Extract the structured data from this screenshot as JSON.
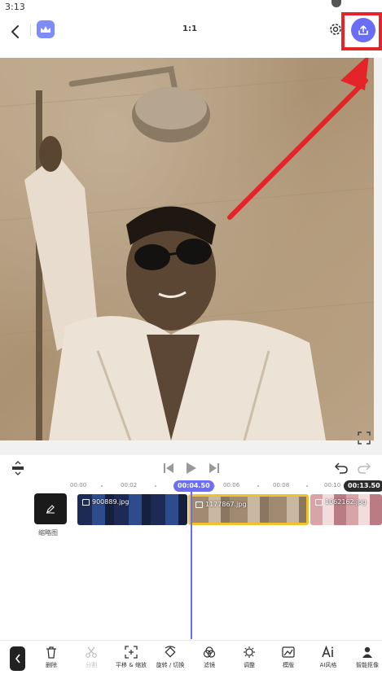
{
  "status": {
    "time": "3:13"
  },
  "header": {
    "ratio": "1:1"
  },
  "timeline": {
    "current_time": "00:04.50",
    "total_time": "00:13.50",
    "ticks": [
      "00:00",
      "00:02",
      "00:06",
      "00:08",
      "00:10"
    ],
    "cover_label": "缩略图",
    "clips": [
      {
        "name": "900889.jpg"
      },
      {
        "name": "1177867.jpg"
      },
      {
        "name": "1062162.jpg"
      }
    ]
  },
  "toolbar": {
    "tools": [
      {
        "label": "删除",
        "icon": "trash-icon"
      },
      {
        "label": "分割",
        "icon": "scissors-icon"
      },
      {
        "label": "平移 & 缩放",
        "icon": "pan-zoom-icon"
      },
      {
        "label": "旋转 / 切换",
        "icon": "rotate-icon"
      },
      {
        "label": "滤镜",
        "icon": "filter-icon"
      },
      {
        "label": "调整",
        "icon": "adjust-icon"
      },
      {
        "label": "模版",
        "icon": "template-icon"
      },
      {
        "label": "AI风格",
        "icon": "ai-style-icon"
      },
      {
        "label": "智能抠像",
        "icon": "cutout-icon"
      }
    ]
  },
  "colors": {
    "accent": "#6a6df5",
    "highlight": "#e5242a",
    "selected_clip": "#f2c12e"
  }
}
